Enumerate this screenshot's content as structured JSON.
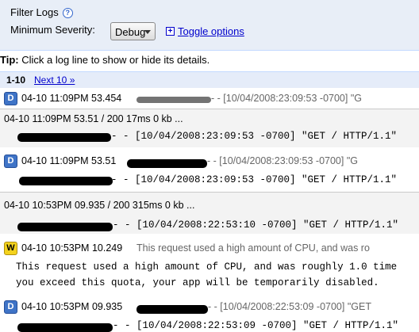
{
  "filter": {
    "title": "Filter Logs",
    "help_glyph": "?",
    "severity_label": "Minimum Severity:",
    "severity_value": "Debug",
    "toggle_label": "Toggle options",
    "plus_glyph": "+"
  },
  "tip": {
    "label": "Tip:",
    "text": "Click a log line to show or hide its details."
  },
  "pager": {
    "range": "1-10",
    "next": "Next 10 »"
  },
  "logs": [
    {
      "badge": "D",
      "time": "04-10 11:09PM 53.454",
      "tail": " - - [10/04/2008:23:09:53 -0700] \"G"
    },
    {
      "summary": "04-10 11:09PM 53.51   /   200 17ms 0 kb ...",
      "detail": " - - [10/04/2008:23:09:53 -0700] \"GET / HTTP/1.1\""
    },
    {
      "badge": "D",
      "time": "04-10 11:09PM 53.51",
      "tail": " - - [10/04/2008:23:09:53 -0700] \"G",
      "detail": " - - [10/04/2008:23:09:53 -0700] \"GET / HTTP/1.1\""
    },
    {
      "summary": "04-10 10:53PM 09.935   /   200 315ms 0 kb ...",
      "detail": " - - [10/04/2008:22:53:10 -0700] \"GET / HTTP/1.1\""
    },
    {
      "badge": "W",
      "time": "04-10 10:53PM 10.249",
      "tail": "This request used a high amount of CPU, and was ro",
      "detail1": "This request used a high amount of CPU, and was roughly 1.0 time",
      "detail2": "you exceed this quota, your app will be temporarily disabled."
    },
    {
      "badge": "D",
      "time": "04-10 10:53PM 09.935",
      "tail": " - - [10/04/2008:22:53:09 -0700] \"GET",
      "detail": " - - [10/04/2008:22:53:09 -0700] \"GET / HTTP/1.1\""
    }
  ]
}
